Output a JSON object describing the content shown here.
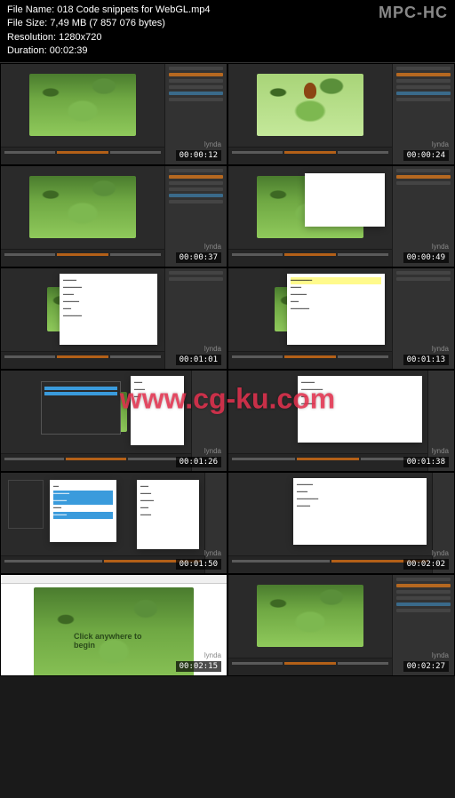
{
  "header": {
    "file_name_label": "File Name:",
    "file_name": "018 Code snippets for WebGL.mp4",
    "file_size_label": "File Size:",
    "file_size": "7,49 MB (7 857 076 bytes)",
    "resolution_label": "Resolution:",
    "resolution": "1280x720",
    "duration_label": "Duration:",
    "duration": "00:02:39",
    "app_logo": "MPC-HC"
  },
  "watermark": "www.cg-ku.com",
  "brand_text": "lynda",
  "thumbnails": [
    {
      "timestamp": "00:00:12",
      "type": "animate-jungle"
    },
    {
      "timestamp": "00:00:24",
      "type": "animate-monkey"
    },
    {
      "timestamp": "00:00:37",
      "type": "animate-jungle"
    },
    {
      "timestamp": "00:00:49",
      "type": "animate-white"
    },
    {
      "timestamp": "00:01:01",
      "type": "animate-code"
    },
    {
      "timestamp": "00:01:13",
      "type": "animate-code-hl"
    },
    {
      "timestamp": "00:01:26",
      "type": "animate-dark-panel"
    },
    {
      "timestamp": "00:01:38",
      "type": "animate-editor"
    },
    {
      "timestamp": "00:01:50",
      "type": "animate-code-sel"
    },
    {
      "timestamp": "00:02:02",
      "type": "animate-editor2"
    },
    {
      "timestamp": "00:02:15",
      "type": "browser-jungle"
    },
    {
      "timestamp": "00:02:27",
      "type": "animate-jungle"
    }
  ],
  "click_text": "Click anywhere to begin"
}
